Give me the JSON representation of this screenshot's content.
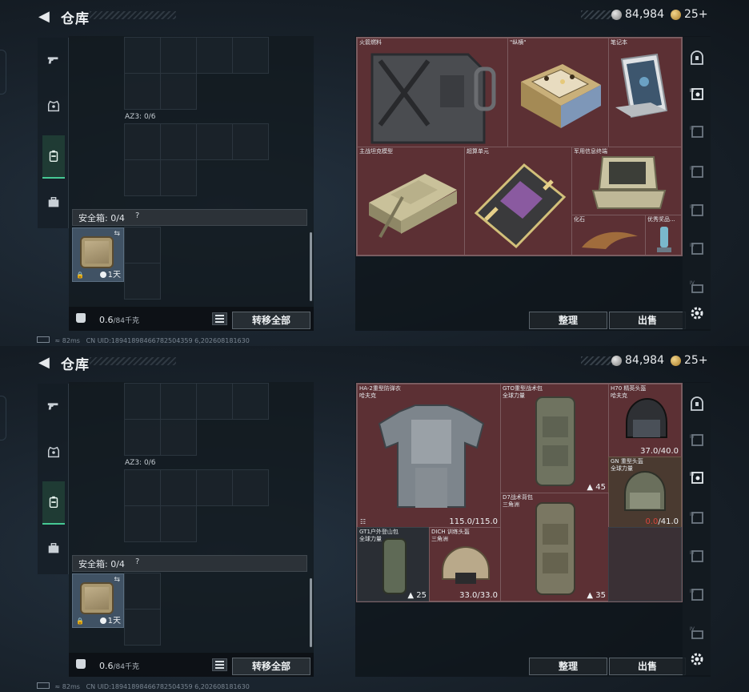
{
  "screens": [
    {
      "header": {
        "back_icon": "arrow-left-icon",
        "title": "仓库",
        "silver": "84,984",
        "gold": "25+"
      },
      "left": {
        "az_label": "AZ3: 0/6",
        "safe_label": "安全箱: 0/4",
        "safe_help": "?",
        "case_time": "1天",
        "weight_value": "0.6",
        "weight_unit": "/84千克",
        "transfer_label": "转移全部"
      },
      "items": [
        {
          "name": "火箭燃料",
          "value": "",
          "lock": ""
        },
        {
          "name": "\"纵横\"",
          "value": "",
          "lock": ""
        },
        {
          "name": "笔记本",
          "value": "",
          "lock": ""
        },
        {
          "name": "主战坦克模型",
          "value": "",
          "lock": ""
        },
        {
          "name": "超算单元",
          "value": "",
          "lock": ""
        },
        {
          "name": "军用信息终端",
          "value": "",
          "lock": ""
        },
        {
          "name": "化石",
          "value": "",
          "lock": ""
        },
        {
          "name": "优秀奖品...",
          "value": "",
          "lock": ""
        }
      ],
      "actions": {
        "sort": "整理",
        "sell": "出售"
      },
      "status": {
        "ping": "82ms",
        "uid": "CN UID:18941898466782504359 6,202608181630"
      }
    },
    {
      "header": {
        "back_icon": "arrow-left-icon",
        "title": "仓库",
        "silver": "84,984",
        "gold": "25+"
      },
      "left": {
        "az_label": "AZ3: 0/6",
        "safe_label": "安全箱: 0/4",
        "safe_help": "?",
        "case_time": "1天",
        "weight_value": "0.6",
        "weight_unit": "/84千克",
        "transfer_label": "转移全部"
      },
      "items": [
        {
          "name": "HA-2重型防弹衣\n哈夫克",
          "value": "115.0/115.0",
          "lock": ""
        },
        {
          "name": "GTO重型战术包\n全球力量",
          "value": "45",
          "lock": ""
        },
        {
          "name": "H70 精英头盔\n哈夫克",
          "value": "37.0/40.0",
          "lock": ""
        },
        {
          "name": "GN 重型头盔\n全球力量",
          "value_red": "0.0",
          "value_rest": "/41.0",
          "lock": ""
        },
        {
          "name": "D7战术背包\n三角洲",
          "value": "35",
          "lock": ""
        },
        {
          "name": "GT1户外登山包\n全球力量",
          "value": "25",
          "lock": ""
        },
        {
          "name": "DICH 训练头盔\n三角洲",
          "value": "33.0/33.0",
          "lock": ""
        }
      ],
      "actions": {
        "sort": "整理",
        "sell": "出售"
      },
      "status": {
        "ping": "82ms",
        "uid": "CN UID:18941898466782504359 6,202608181630"
      }
    }
  ]
}
